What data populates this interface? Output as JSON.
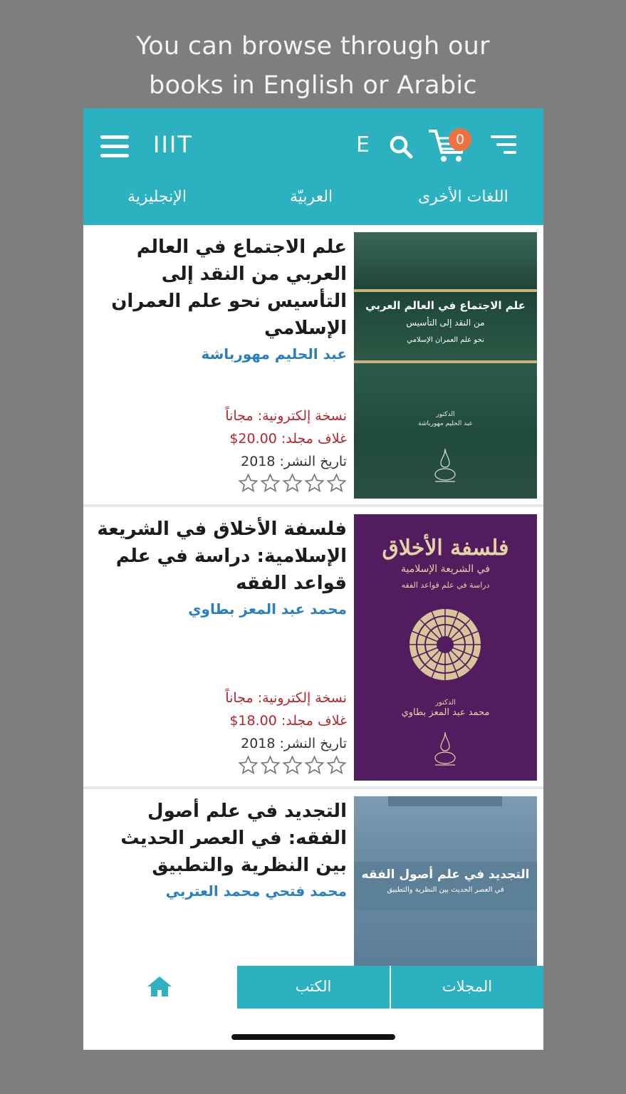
{
  "caption": {
    "line1": "You can browse through our",
    "line2": "books in English or Arabic"
  },
  "header": {
    "app_title": "IIIT",
    "lang_toggle": "E",
    "cart_count": "0",
    "icons": [
      "menu-icon",
      "search-icon",
      "cart-icon",
      "sort-icon"
    ]
  },
  "language_tabs": [
    "اللغات الأخرى",
    "العربيّة",
    "الإنجليزية"
  ],
  "books": [
    {
      "title": "علم الاجتماع في العالم العربي من النقد إلى التأسيس نحو علم العمران الإسلامي",
      "author": "عبد الحليم مهورباشة",
      "ebook_label": "نسخة إلكترونية: مجاناً",
      "hardcover_label": "غلاف مجلد:",
      "hardcover_price": "$20.00",
      "date_label": "تاريخ النشر:",
      "date_value": "2018",
      "rating": 0,
      "cover": {
        "title": "علم الاجتماع في العالم العربي",
        "subtitle": "من النقد إلى التأسيس",
        "tagline": "نحو علم العمران الإسلامي",
        "author_label": "الدكتور",
        "author": "عبد الحليم مهورباشة",
        "colors": [
          "#1f4a3a",
          "#2e5e4c"
        ]
      }
    },
    {
      "title": "فلسفة الأخلاق في الشريعة الإسلامية: دراسة في علم قواعد الفقه",
      "author": "محمد عبد المعز بطاوي",
      "ebook_label": "نسخة إلكترونية: مجاناً",
      "hardcover_label": "غلاف مجلد:",
      "hardcover_price": "$18.00",
      "date_label": "تاريخ النشر:",
      "date_value": "2018",
      "rating": 0,
      "cover": {
        "title": "فلسفة الأخلاق",
        "subtitle": "في الشريعة الإسلامية",
        "tagline": "دراسة في علم قواعد الفقه",
        "author_label": "الدكتور",
        "author": "محمد عبد المعز بطاوي",
        "colors": [
          "#5a2166",
          "#4a1a55"
        ]
      }
    },
    {
      "title": "التجديد في علم أصول الفقه: في العصر الحديث بين النظرية والتطبيق",
      "author": "محمد فتحي محمد العتربي",
      "cover": {
        "title": "التجديد في علم أصول الفقه",
        "subtitle": "في العصر الحديث بين النظرية والتطبيق",
        "colors": [
          "#6e8fa8",
          "#5d7f99"
        ]
      }
    }
  ],
  "bottom_nav": {
    "home_icon": "home-icon",
    "books": "الكتب",
    "journals": "المجلات",
    "active_bg": "#ffffff",
    "inactive_bg": "#2cb1c1"
  },
  "colors": {
    "accent": "#2cb1c1",
    "price": "#b8242d",
    "author": "#2a7fbf",
    "badge": "#f0713f"
  }
}
